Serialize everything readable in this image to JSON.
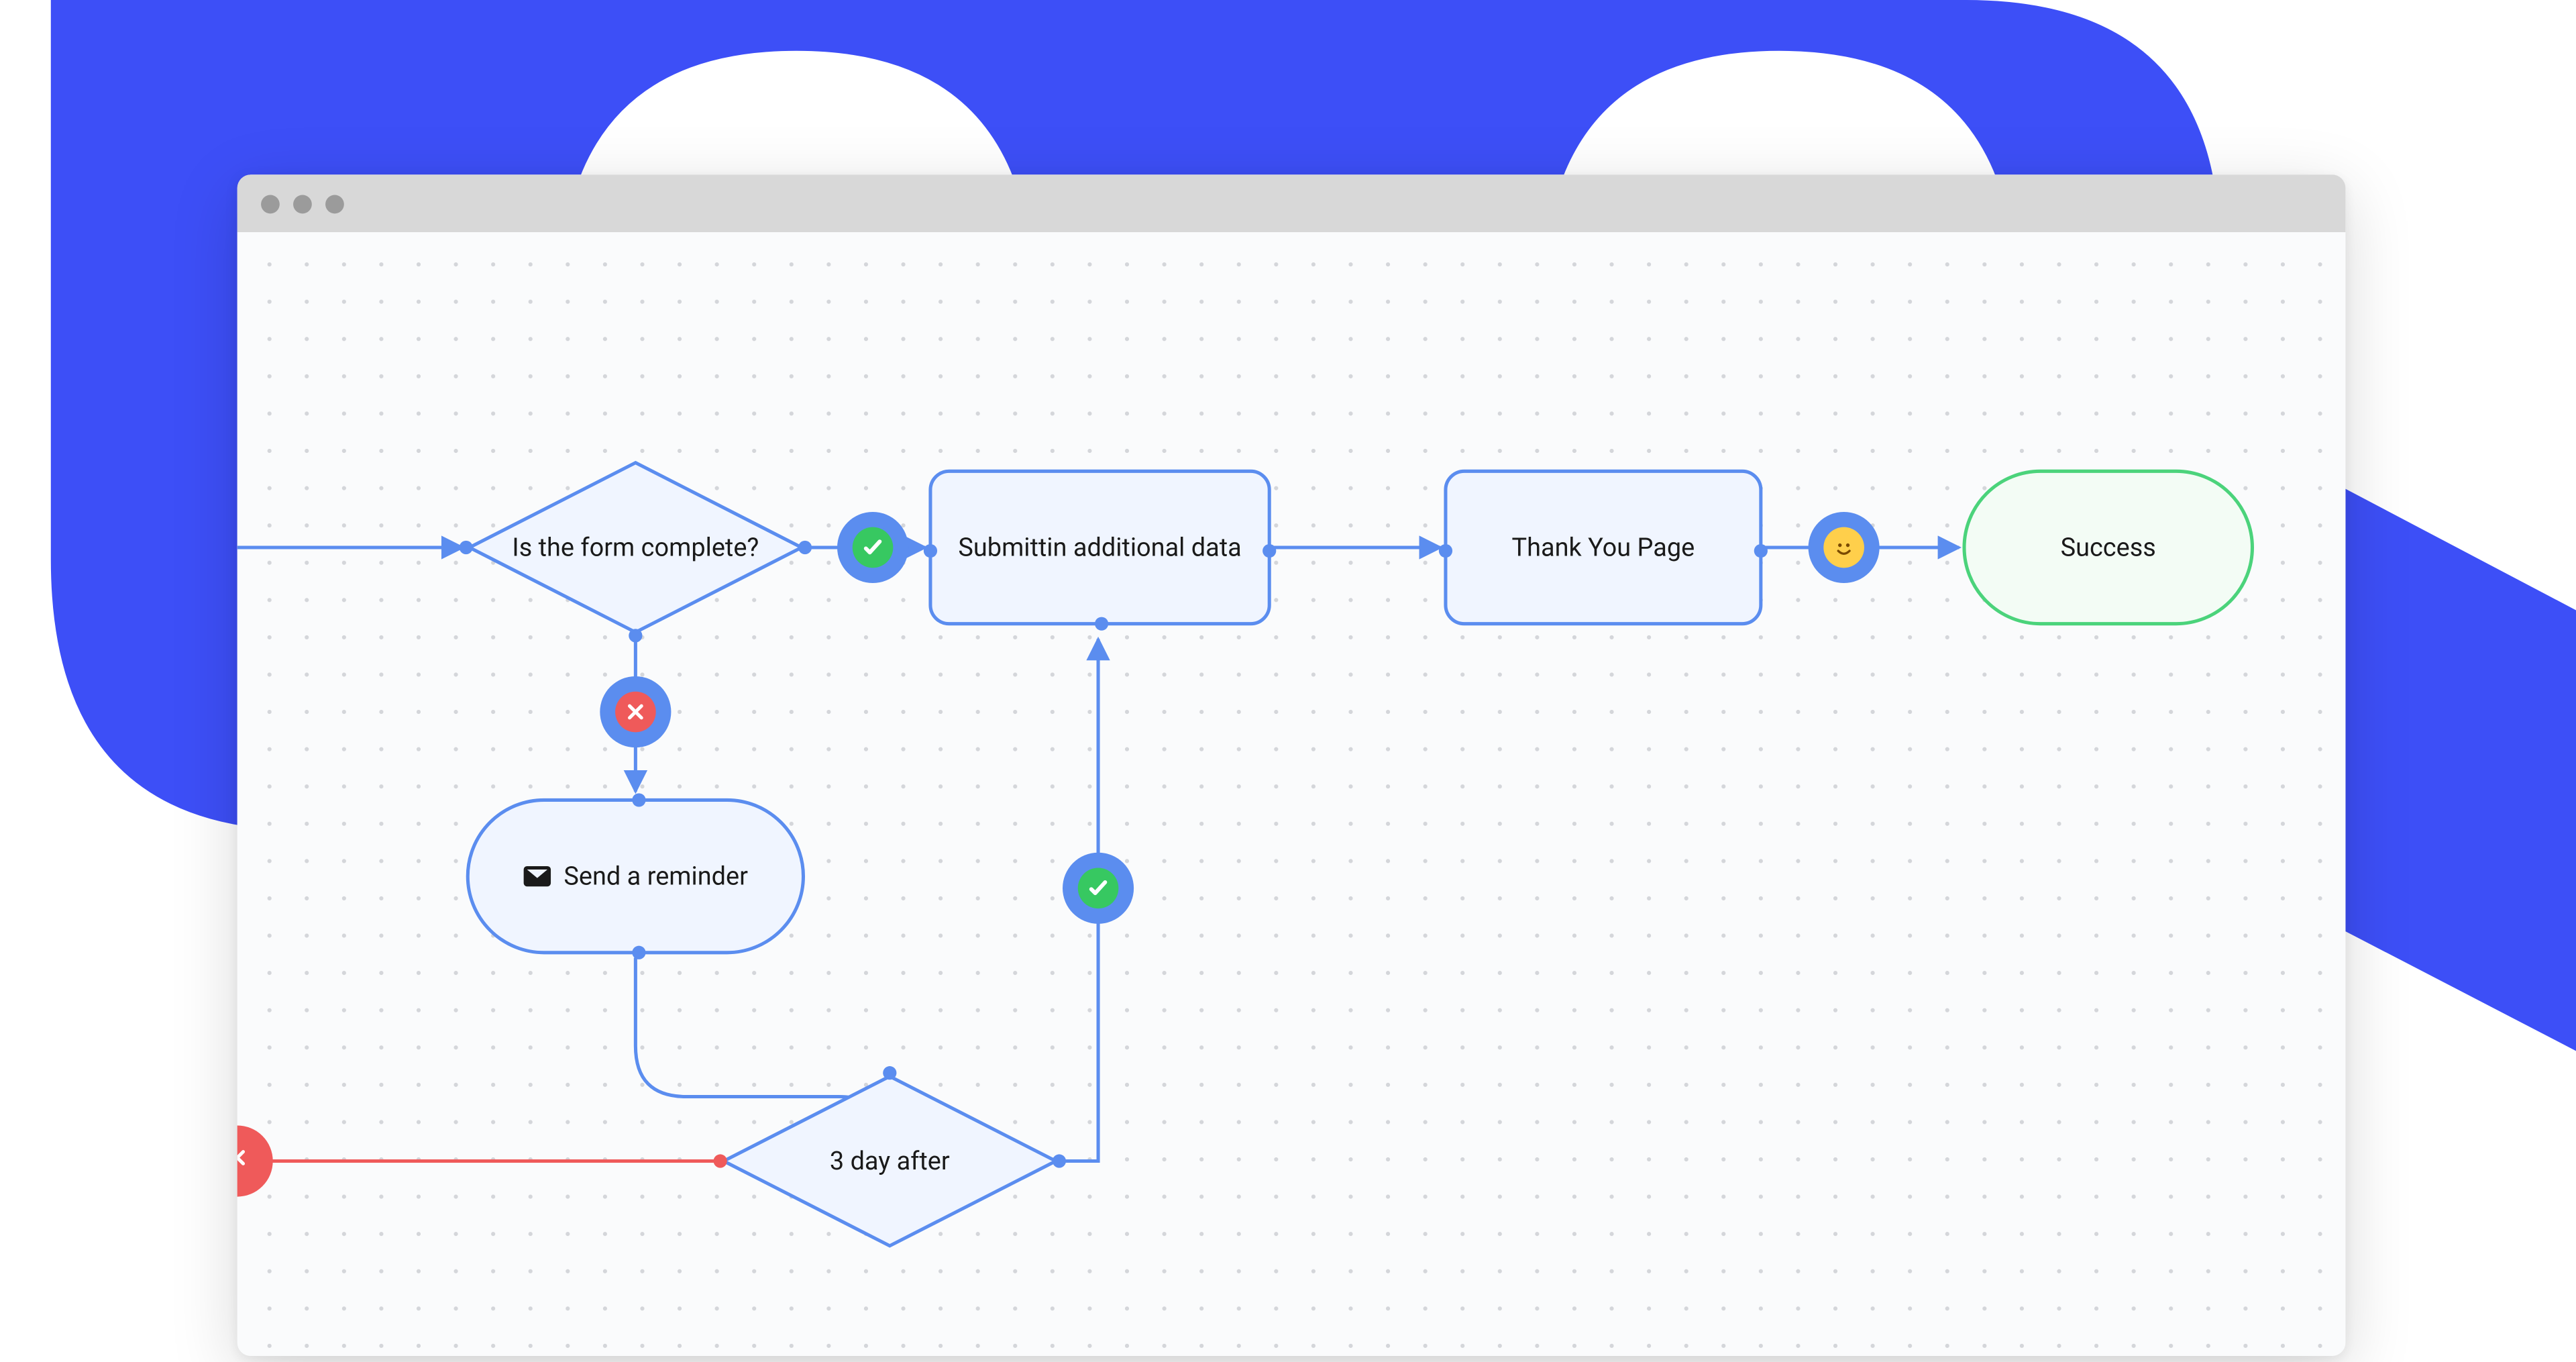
{
  "nodes": {
    "decision_form": "Is the form complete?",
    "submit_data": "Submittin additional data",
    "thank_you": "Thank You Page",
    "success": "Success",
    "send_reminder": "Send a reminder",
    "wait_3_days": "3 day after"
  },
  "badges": {
    "yes": "check-icon",
    "no": "cross-icon",
    "loop_yes": "check-icon",
    "done": "smile-icon",
    "fail": "cross-icon"
  },
  "colors": {
    "accent_blue": "#5b8def",
    "fill_blue": "#f0f5ff",
    "accent_green": "#4bd37b",
    "fill_green": "#f3fcf5",
    "badge_green": "#37c861",
    "badge_red": "#ef5a5a",
    "badge_yellow": "#ffcf4b",
    "bg_brand": "#3d4ff7"
  }
}
